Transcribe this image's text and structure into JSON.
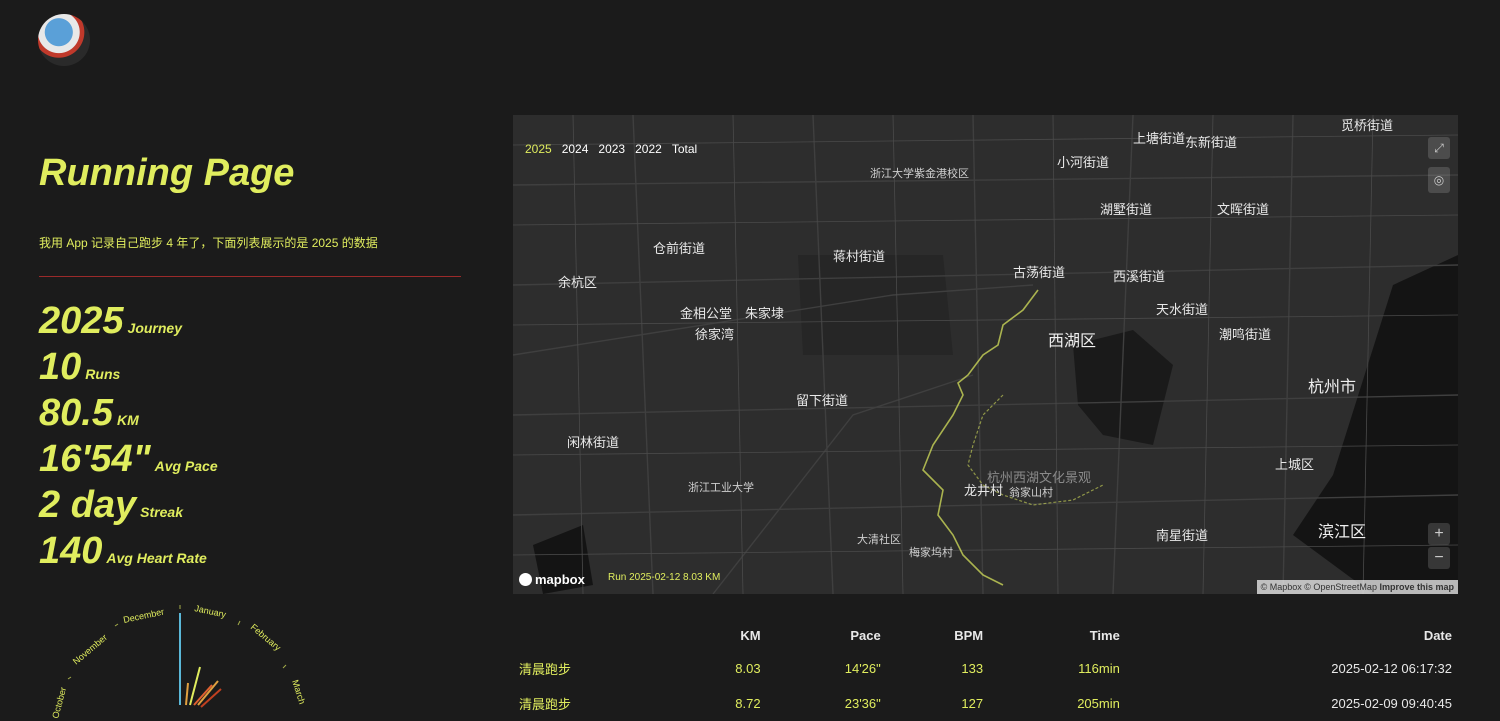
{
  "site": {
    "title": "Running Page",
    "description": "我用 App 记录自己跑步 4 年了，下面列表展示的是 2025 的数据"
  },
  "stats": [
    {
      "value": "2025",
      "label": "Journey"
    },
    {
      "value": "10",
      "label": "Runs"
    },
    {
      "value": "80.5",
      "label": "KM"
    },
    {
      "value": "16'54\"",
      "label": "Avg Pace"
    },
    {
      "value": "2 day",
      "label": "Streak"
    },
    {
      "value": "140",
      "label": "Avg Heart Rate"
    }
  ],
  "radial_months": [
    "October",
    "November",
    "December",
    "January",
    "February",
    "March"
  ],
  "map": {
    "years": [
      "2025",
      "2024",
      "2023",
      "2022",
      "Total"
    ],
    "active_year": "2025",
    "run_label": "Run 2025-02-12 8.03 KM",
    "logo": "mapbox",
    "attribution": "© Mapbox © OpenStreetMap",
    "improve": "Improve this map",
    "route_color": "#e0ed5e",
    "labels": {
      "xihu": "西湖区",
      "hangzhou": "杭州市",
      "binjiang": "滨江区",
      "yuhang": "余杭区",
      "shangcheng": "上城区",
      "xihu_scenic": "杭州西湖文化景观",
      "longjing": "龙井村",
      "gudang": "古荡街道",
      "xixi_st": "西溪街道",
      "jiangcun": "蒋村街道",
      "liuxia": "留下街道",
      "xianlin": "闲林街道",
      "cangqian": "仓前街道",
      "jinxiang": "金相公堂",
      "zhujia": "朱家埭",
      "xujia": "徐家湾",
      "tianshui": "天水街道",
      "chaoming": "潮鸣街道",
      "xiaohe": "小河街道",
      "hushu": "湖墅街道",
      "wenhui": "文晖街道",
      "shangtang": "上塘街道",
      "dongxin": "东新街道",
      "nanxing": "南星街道",
      "zju_zijingang": "浙江大学紫金港校区",
      "zjut": "浙江工业大学",
      "wengjiashan": "翁家山村",
      "meijiawu": "梅家坞村",
      "daqing": "大清社区",
      "jianqiao": "觅桥街道"
    }
  },
  "table": {
    "headers": [
      "",
      "KM",
      "Pace",
      "BPM",
      "Time",
      "Date"
    ],
    "rows": [
      {
        "name": "清晨跑步",
        "km": "8.03",
        "pace": "14'26\"",
        "bpm": "133",
        "time": "116min",
        "date": "2025-02-12 06:17:32"
      },
      {
        "name": "清晨跑步",
        "km": "8.72",
        "pace": "23'36\"",
        "bpm": "127",
        "time": "205min",
        "date": "2025-02-09 09:40:45"
      }
    ]
  }
}
